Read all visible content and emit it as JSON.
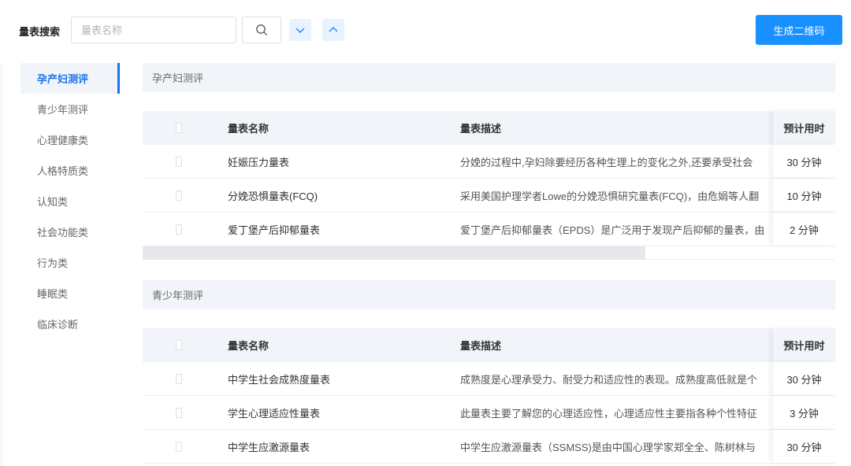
{
  "search": {
    "label": "量表搜索",
    "placeholder": "量表名称",
    "value": ""
  },
  "toolbar": {
    "qr_label": "生成二维码"
  },
  "sidebar": {
    "items": [
      {
        "label": "孕产妇测评",
        "active": true
      },
      {
        "label": "青少年测评",
        "active": false
      },
      {
        "label": "心理健康类",
        "active": false
      },
      {
        "label": "人格特质类",
        "active": false
      },
      {
        "label": "认知类",
        "active": false
      },
      {
        "label": "社会功能类",
        "active": false
      },
      {
        "label": "行为类",
        "active": false
      },
      {
        "label": "睡眠类",
        "active": false
      },
      {
        "label": "临床诊断",
        "active": false
      }
    ]
  },
  "sections": [
    {
      "title": "孕产妇测评",
      "headers": {
        "name": "量表名称",
        "desc": "量表描述",
        "time": "预计用时"
      },
      "rows": [
        {
          "name": "妊娠压力量表",
          "desc": "分娩的过程中,孕妇除要经历各种生理上的变化之外,还要承受社会",
          "time": "30 分钟"
        },
        {
          "name": "分娩恐惧量表(FCQ)",
          "desc": "采用美国护理学者Lowe的分娩恐惧研究量表(FCQ)，由危娟等人翻",
          "time": "10 分钟"
        },
        {
          "name": "爱丁堡产后抑郁量表",
          "desc": "爱丁堡产后抑郁量表（EPDS）是广泛用于发现产后抑郁的量表，由",
          "time": "2 分钟"
        }
      ]
    },
    {
      "title": "青少年测评",
      "headers": {
        "name": "量表名称",
        "desc": "量表描述",
        "time": "预计用时"
      },
      "rows": [
        {
          "name": "中学生社会成熟度量表",
          "desc": "成熟度是心理承受力、耐受力和适应性的表现。成熟度高低就是个",
          "time": "30 分钟"
        },
        {
          "name": "学生心理适应性量表",
          "desc": "此量表主要了解您的心理适应性，心理适应性主要指各种个性特征",
          "time": "3 分钟"
        },
        {
          "name": "中学生应激源量表",
          "desc": "中学生应激源量表（SSMSS)是由中国心理学家郑全全、陈树林与",
          "time": "30 分钟"
        }
      ]
    }
  ],
  "colors": {
    "accent": "#1890ff",
    "active_text": "#1a73e8",
    "section_bg": "#f1f4f9"
  }
}
